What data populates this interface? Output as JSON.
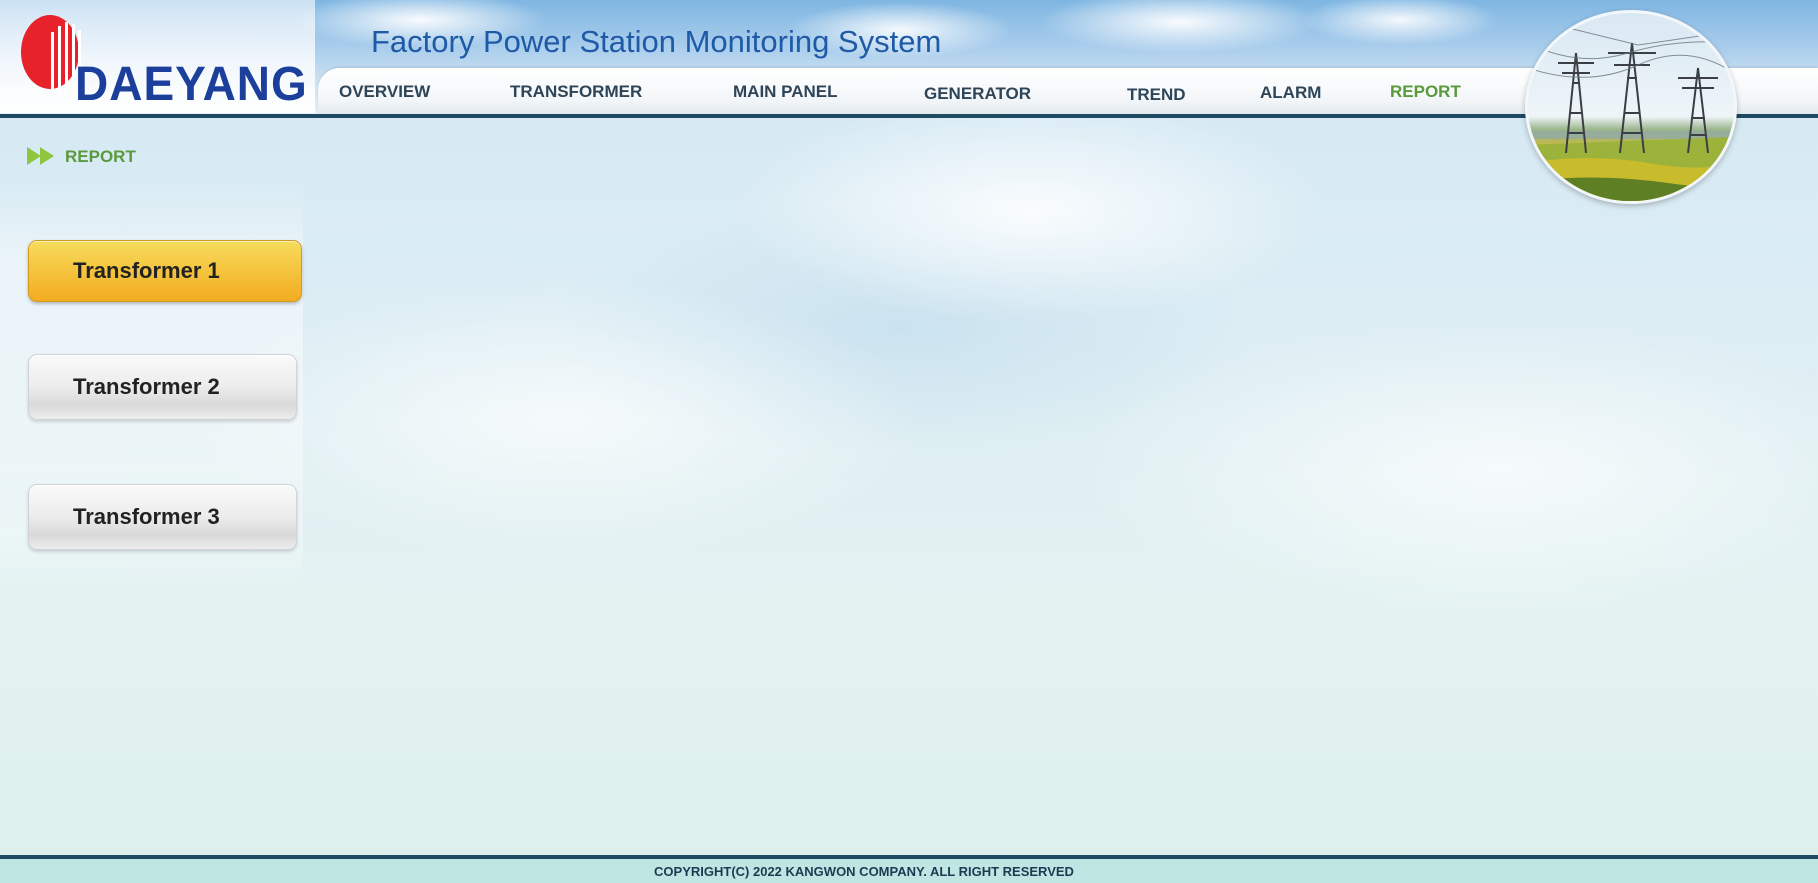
{
  "header": {
    "logo_text": "DAEYANG",
    "title": "Factory Power Station Monitoring System",
    "nav": [
      {
        "label": "OVERVIEW",
        "active": false
      },
      {
        "label": "TRANSFORMER",
        "active": false
      },
      {
        "label": "MAIN PANEL",
        "active": false
      },
      {
        "label": "GENERATOR",
        "active": false
      },
      {
        "label": "TREND",
        "active": false
      },
      {
        "label": "ALARM",
        "active": false
      },
      {
        "label": "REPORT",
        "active": true
      }
    ]
  },
  "breadcrumb": {
    "label": "REPORT",
    "icon": "double-arrow-icon"
  },
  "sidebar": {
    "buttons": [
      {
        "label": "Transformer 1",
        "active": true
      },
      {
        "label": "Transformer 2",
        "active": false
      },
      {
        "label": "Transformer 3",
        "active": false
      }
    ]
  },
  "footer": {
    "copyright": "COPYRIGHT(C) 2022 KANGWON COMPANY. ALL RIGHT RESERVED"
  },
  "colors": {
    "brand_blue": "#1c3f9c",
    "accent_green": "#5a9a3c",
    "active_button": "#f5c640",
    "header_line": "#1f4a63"
  }
}
